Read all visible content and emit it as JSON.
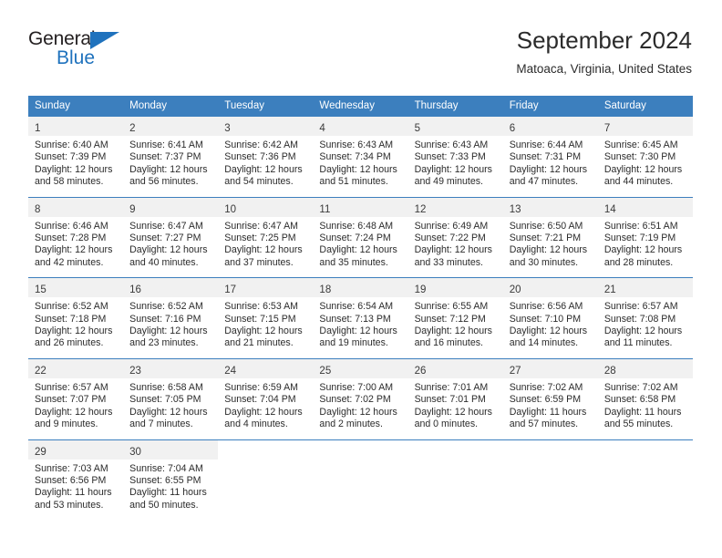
{
  "brand": {
    "name_top": "General",
    "name_bottom": "Blue",
    "accent_color": "#1f72bd"
  },
  "header": {
    "title": "September 2024",
    "subtitle": "Matoaca, Virginia, United States"
  },
  "calendar": {
    "header_bg": "#3c7fbe",
    "day_band_bg": "#f1f1f1",
    "weekdays": [
      "Sunday",
      "Monday",
      "Tuesday",
      "Wednesday",
      "Thursday",
      "Friday",
      "Saturday"
    ],
    "weeks": [
      [
        {
          "day": "1",
          "lines": [
            "Sunrise: 6:40 AM",
            "Sunset: 7:39 PM",
            "Daylight: 12 hours",
            "and 58 minutes."
          ]
        },
        {
          "day": "2",
          "lines": [
            "Sunrise: 6:41 AM",
            "Sunset: 7:37 PM",
            "Daylight: 12 hours",
            "and 56 minutes."
          ]
        },
        {
          "day": "3",
          "lines": [
            "Sunrise: 6:42 AM",
            "Sunset: 7:36 PM",
            "Daylight: 12 hours",
            "and 54 minutes."
          ]
        },
        {
          "day": "4",
          "lines": [
            "Sunrise: 6:43 AM",
            "Sunset: 7:34 PM",
            "Daylight: 12 hours",
            "and 51 minutes."
          ]
        },
        {
          "day": "5",
          "lines": [
            "Sunrise: 6:43 AM",
            "Sunset: 7:33 PM",
            "Daylight: 12 hours",
            "and 49 minutes."
          ]
        },
        {
          "day": "6",
          "lines": [
            "Sunrise: 6:44 AM",
            "Sunset: 7:31 PM",
            "Daylight: 12 hours",
            "and 47 minutes."
          ]
        },
        {
          "day": "7",
          "lines": [
            "Sunrise: 6:45 AM",
            "Sunset: 7:30 PM",
            "Daylight: 12 hours",
            "and 44 minutes."
          ]
        }
      ],
      [
        {
          "day": "8",
          "lines": [
            "Sunrise: 6:46 AM",
            "Sunset: 7:28 PM",
            "Daylight: 12 hours",
            "and 42 minutes."
          ]
        },
        {
          "day": "9",
          "lines": [
            "Sunrise: 6:47 AM",
            "Sunset: 7:27 PM",
            "Daylight: 12 hours",
            "and 40 minutes."
          ]
        },
        {
          "day": "10",
          "lines": [
            "Sunrise: 6:47 AM",
            "Sunset: 7:25 PM",
            "Daylight: 12 hours",
            "and 37 minutes."
          ]
        },
        {
          "day": "11",
          "lines": [
            "Sunrise: 6:48 AM",
            "Sunset: 7:24 PM",
            "Daylight: 12 hours",
            "and 35 minutes."
          ]
        },
        {
          "day": "12",
          "lines": [
            "Sunrise: 6:49 AM",
            "Sunset: 7:22 PM",
            "Daylight: 12 hours",
            "and 33 minutes."
          ]
        },
        {
          "day": "13",
          "lines": [
            "Sunrise: 6:50 AM",
            "Sunset: 7:21 PM",
            "Daylight: 12 hours",
            "and 30 minutes."
          ]
        },
        {
          "day": "14",
          "lines": [
            "Sunrise: 6:51 AM",
            "Sunset: 7:19 PM",
            "Daylight: 12 hours",
            "and 28 minutes."
          ]
        }
      ],
      [
        {
          "day": "15",
          "lines": [
            "Sunrise: 6:52 AM",
            "Sunset: 7:18 PM",
            "Daylight: 12 hours",
            "and 26 minutes."
          ]
        },
        {
          "day": "16",
          "lines": [
            "Sunrise: 6:52 AM",
            "Sunset: 7:16 PM",
            "Daylight: 12 hours",
            "and 23 minutes."
          ]
        },
        {
          "day": "17",
          "lines": [
            "Sunrise: 6:53 AM",
            "Sunset: 7:15 PM",
            "Daylight: 12 hours",
            "and 21 minutes."
          ]
        },
        {
          "day": "18",
          "lines": [
            "Sunrise: 6:54 AM",
            "Sunset: 7:13 PM",
            "Daylight: 12 hours",
            "and 19 minutes."
          ]
        },
        {
          "day": "19",
          "lines": [
            "Sunrise: 6:55 AM",
            "Sunset: 7:12 PM",
            "Daylight: 12 hours",
            "and 16 minutes."
          ]
        },
        {
          "day": "20",
          "lines": [
            "Sunrise: 6:56 AM",
            "Sunset: 7:10 PM",
            "Daylight: 12 hours",
            "and 14 minutes."
          ]
        },
        {
          "day": "21",
          "lines": [
            "Sunrise: 6:57 AM",
            "Sunset: 7:08 PM",
            "Daylight: 12 hours",
            "and 11 minutes."
          ]
        }
      ],
      [
        {
          "day": "22",
          "lines": [
            "Sunrise: 6:57 AM",
            "Sunset: 7:07 PM",
            "Daylight: 12 hours",
            "and 9 minutes."
          ]
        },
        {
          "day": "23",
          "lines": [
            "Sunrise: 6:58 AM",
            "Sunset: 7:05 PM",
            "Daylight: 12 hours",
            "and 7 minutes."
          ]
        },
        {
          "day": "24",
          "lines": [
            "Sunrise: 6:59 AM",
            "Sunset: 7:04 PM",
            "Daylight: 12 hours",
            "and 4 minutes."
          ]
        },
        {
          "day": "25",
          "lines": [
            "Sunrise: 7:00 AM",
            "Sunset: 7:02 PM",
            "Daylight: 12 hours",
            "and 2 minutes."
          ]
        },
        {
          "day": "26",
          "lines": [
            "Sunrise: 7:01 AM",
            "Sunset: 7:01 PM",
            "Daylight: 12 hours",
            "and 0 minutes."
          ]
        },
        {
          "day": "27",
          "lines": [
            "Sunrise: 7:02 AM",
            "Sunset: 6:59 PM",
            "Daylight: 11 hours",
            "and 57 minutes."
          ]
        },
        {
          "day": "28",
          "lines": [
            "Sunrise: 7:02 AM",
            "Sunset: 6:58 PM",
            "Daylight: 11 hours",
            "and 55 minutes."
          ]
        }
      ],
      [
        {
          "day": "29",
          "lines": [
            "Sunrise: 7:03 AM",
            "Sunset: 6:56 PM",
            "Daylight: 11 hours",
            "and 53 minutes."
          ]
        },
        {
          "day": "30",
          "lines": [
            "Sunrise: 7:04 AM",
            "Sunset: 6:55 PM",
            "Daylight: 11 hours",
            "and 50 minutes."
          ]
        },
        {
          "day": "",
          "lines": []
        },
        {
          "day": "",
          "lines": []
        },
        {
          "day": "",
          "lines": []
        },
        {
          "day": "",
          "lines": []
        },
        {
          "day": "",
          "lines": []
        }
      ]
    ]
  }
}
